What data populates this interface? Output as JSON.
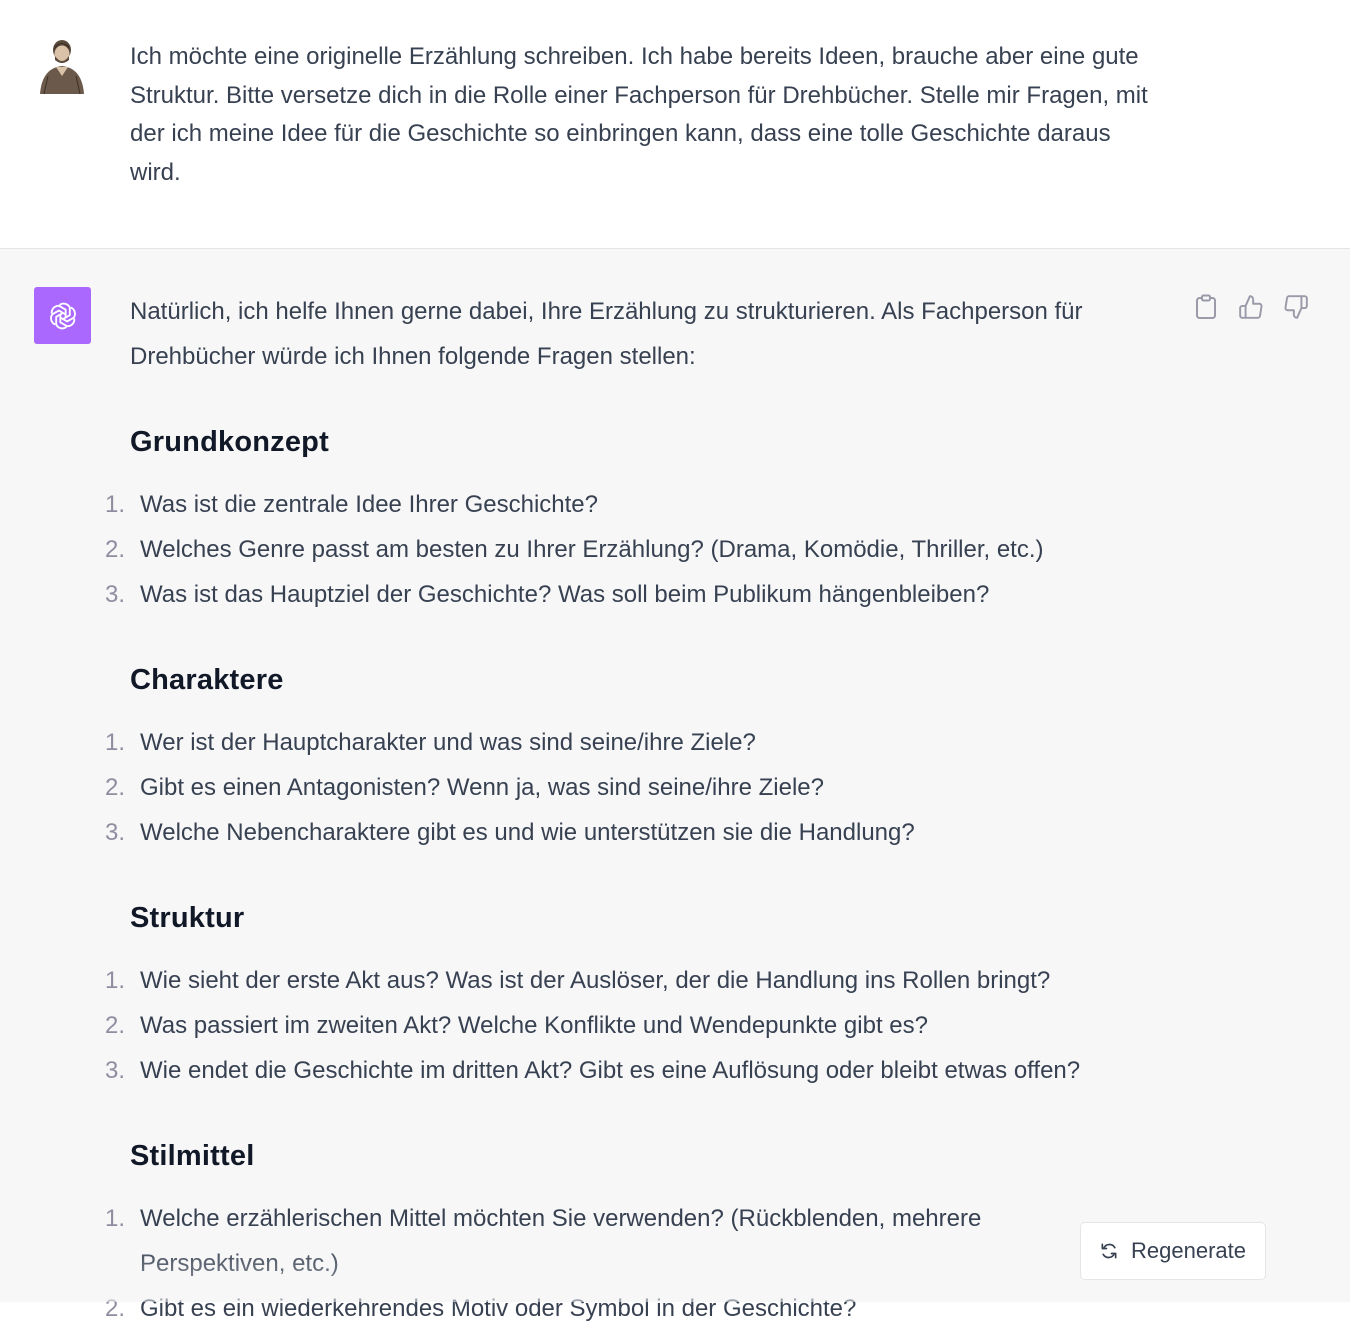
{
  "user_message": {
    "text": "Ich möchte eine originelle Erzählung schreiben. Ich habe bereits Ideen, brauche aber eine gute Struktur. Bitte versetze dich in die Rolle einer Fachperson für Drehbücher. Stelle mir Fragen, mit der ich meine Idee für die Geschichte so einbringen kann, dass eine tolle Geschichte daraus wird.",
    "avatar_icon": "user-portrait-sketch"
  },
  "assistant_message": {
    "avatar_icon": "openai-logo",
    "avatar_color": "#ab68ff",
    "intro": "Natürlich, ich helfe Ihnen gerne dabei, Ihre Erzählung zu strukturieren. Als Fachperson für Drehbücher würde ich Ihnen folgende Fragen stellen:",
    "sections": [
      {
        "heading": "Grundkonzept",
        "items": [
          "Was ist die zentrale Idee Ihrer Geschichte?",
          "Welches Genre passt am besten zu Ihrer Erzählung? (Drama, Komödie, Thriller, etc.)",
          "Was ist das Hauptziel der Geschichte? Was soll beim Publikum hängenbleiben?"
        ]
      },
      {
        "heading": "Charaktere",
        "items": [
          "Wer ist der Hauptcharakter und was sind seine/ihre Ziele?",
          "Gibt es einen Antagonisten? Wenn ja, was sind seine/ihre Ziele?",
          "Welche Nebencharaktere gibt es und wie unterstützen sie die Handlung?"
        ]
      },
      {
        "heading": "Struktur",
        "items": [
          "Wie sieht der erste Akt aus? Was ist der Auslöser, der die Handlung ins Rollen bringt?",
          "Was passiert im zweiten Akt? Welche Konflikte und Wendepunkte gibt es?",
          "Wie endet die Geschichte im dritten Akt? Gibt es eine Auflösung oder bleibt etwas offen?"
        ]
      },
      {
        "heading": "Stilmittel",
        "items": [
          "Welche erzählerischen Mittel möchten Sie verwenden? (Rückblenden, mehrere Perspektiven, etc.)",
          "Gibt es ein wiederkehrendes Motiv oder Symbol in der Geschichte?"
        ]
      }
    ],
    "numbers": [
      "1.",
      "2.",
      "3."
    ]
  },
  "actions": {
    "copy_icon": "clipboard-icon",
    "like_icon": "thumbs-up-icon",
    "dislike_icon": "thumbs-down-icon"
  },
  "regenerate": {
    "label": "Regenerate",
    "icon": "refresh-icon"
  }
}
